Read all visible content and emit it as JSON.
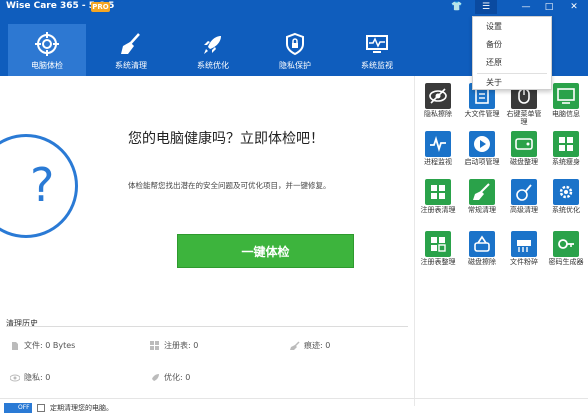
{
  "app": {
    "title": "Wise Care 365 - 5.6.5",
    "badge": "PRO"
  },
  "titlebar": {
    "shirt_icon": "👕",
    "menu_icon": "☰",
    "minimize": "—",
    "maximize": "□",
    "close": "✕"
  },
  "nav": {
    "items": [
      {
        "label": "电脑体检",
        "icon": "target-icon"
      },
      {
        "label": "系统清理",
        "icon": "broom-icon"
      },
      {
        "label": "系统优化",
        "icon": "rocket-icon"
      },
      {
        "label": "隐私保护",
        "icon": "shield-icon"
      },
      {
        "label": "系统监视",
        "icon": "monitor-icon"
      }
    ]
  },
  "menu": {
    "items": [
      "设置",
      "备份",
      "还原",
      "关于"
    ]
  },
  "main": {
    "headline": "您的电脑健康吗？立即体检吧！",
    "description": "体检能帮您找出潜在的安全问题及可优化项目，并一键修复。",
    "check_button": "一键体检",
    "question_mark": "?"
  },
  "history": {
    "title": "清理历史",
    "items": [
      {
        "label": "文件: 0 Bytes"
      },
      {
        "label": "注册表: 0"
      },
      {
        "label": "痕迹: 0"
      },
      {
        "label": "隐私: 0"
      },
      {
        "label": "优化: 0"
      }
    ]
  },
  "tools": [
    {
      "label": "隐私擦除",
      "color": "#3a3a3a"
    },
    {
      "label": "大文件管理",
      "color": "#1b73c9"
    },
    {
      "label": "右键菜单管理",
      "color": "#3a3a3a"
    },
    {
      "label": "电脑信息",
      "color": "#2aa24a"
    },
    {
      "label": "进程监视",
      "color": "#1b73c9"
    },
    {
      "label": "启动项管理",
      "color": "#1b73c9"
    },
    {
      "label": "磁盘整理",
      "color": "#2aa24a"
    },
    {
      "label": "系统瘦身",
      "color": "#2aa24a"
    },
    {
      "label": "注册表清理",
      "color": "#2aa24a"
    },
    {
      "label": "常规清理",
      "color": "#2aa24a"
    },
    {
      "label": "高级清理",
      "color": "#1b73c9"
    },
    {
      "label": "系统优化",
      "color": "#1b73c9"
    },
    {
      "label": "注册表整理",
      "color": "#2aa24a"
    },
    {
      "label": "磁盘擦除",
      "color": "#1b73c9"
    },
    {
      "label": "文件粉碎",
      "color": "#1b73c9"
    },
    {
      "label": "密码生成器",
      "color": "#2aa24a"
    }
  ],
  "footer": {
    "toggle": "OFF",
    "text": "定期清理您的电脑。"
  }
}
